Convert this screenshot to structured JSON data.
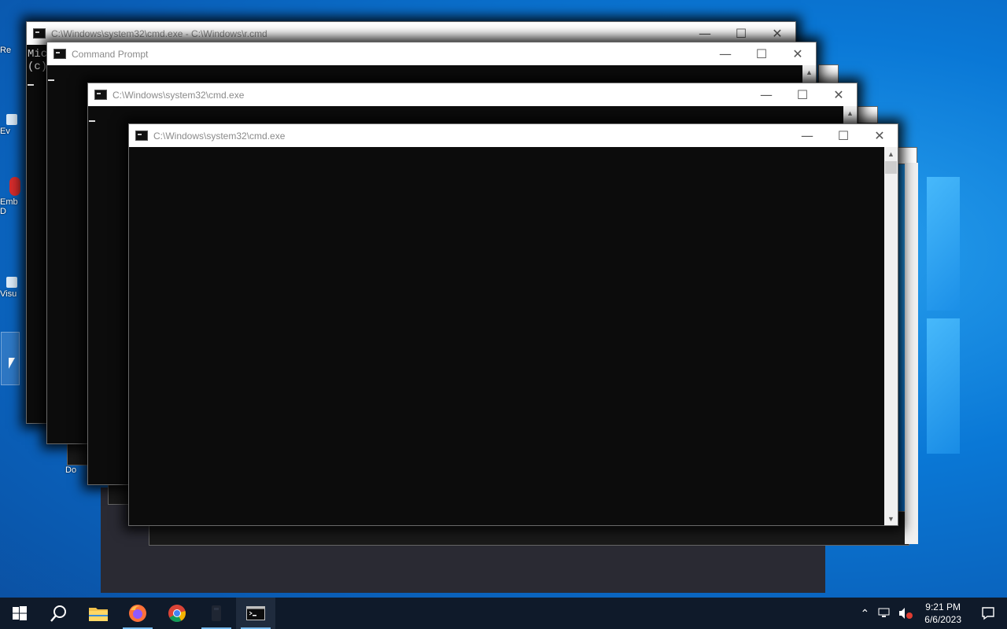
{
  "desktop": {
    "icon_labels": [
      "Re",
      "Ev",
      "Emb D",
      "Visu",
      "Do"
    ]
  },
  "windows": [
    {
      "title": "C:\\Windows\\system32\\cmd.exe - C:\\Windows\\r.cmd",
      "console_lines": [
        "Mic",
        "(c)"
      ]
    },
    {
      "title": "Command Prompt",
      "console_lines": []
    },
    {
      "title": "C:\\Windows\\system32\\cmd.exe",
      "console_lines": []
    },
    {
      "title": "C:\\Windows\\system32\\cmd.exe",
      "console_lines": []
    }
  ],
  "window_controls": {
    "minimize": "—",
    "maximize": "☐",
    "close": "✕"
  },
  "taskbar": {
    "apps": [
      "start-icon",
      "search-icon",
      "file-explorer-icon",
      "firefox-icon",
      "chrome-icon",
      "app-icon",
      "cmd-icon"
    ],
    "clock_time": "9:21 PM",
    "clock_date": "6/6/2023"
  }
}
